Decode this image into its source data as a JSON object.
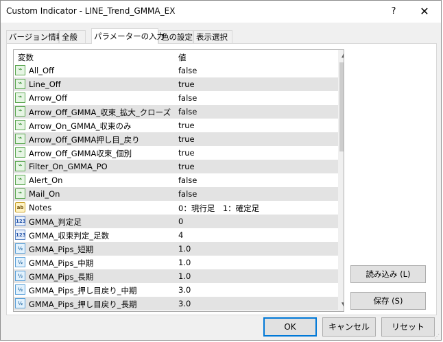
{
  "window": {
    "title": "Custom Indicator - LINE_Trend_GMMA_EX",
    "help_label": "?",
    "close_label": "✕"
  },
  "tabs": [
    {
      "label": "バージョン情報",
      "active": false
    },
    {
      "label": "全般",
      "active": false
    },
    {
      "label": "パラメーターの入力",
      "active": true
    },
    {
      "label": "色の設定",
      "active": false
    },
    {
      "label": "表示選択",
      "active": false
    }
  ],
  "grid": {
    "header": {
      "variable": "変数",
      "value": "値"
    },
    "rows": [
      {
        "icon": "trend-icon",
        "name": "All_Off",
        "value": "false"
      },
      {
        "icon": "trend-icon",
        "name": "Line_Off",
        "value": "true"
      },
      {
        "icon": "trend-icon",
        "name": "Arrow_Off",
        "value": "false"
      },
      {
        "icon": "trend-icon",
        "name": "Arrow_Off_GMMA_収束_拡大_クローズ",
        "value": "false"
      },
      {
        "icon": "trend-icon",
        "name": "Arrow_On_GMMA_収束のみ",
        "value": "true"
      },
      {
        "icon": "trend-icon",
        "name": "Arrow_Off_GMMA押し目_戻り",
        "value": "true"
      },
      {
        "icon": "trend-icon",
        "name": "Arrow_Off_GMMA収束_個別",
        "value": "true"
      },
      {
        "icon": "trend-icon",
        "name": "Filter_On_GMMA_PO",
        "value": "true"
      },
      {
        "icon": "trend-icon",
        "name": "Alert_On",
        "value": "false"
      },
      {
        "icon": "trend-icon",
        "name": "Mail_On",
        "value": "false"
      },
      {
        "icon": "text-icon",
        "name": "Notes",
        "value": "0：現行足　1：確定足"
      },
      {
        "icon": "integer-icon",
        "name": "GMMA_判定足",
        "value": "0"
      },
      {
        "icon": "integer-icon",
        "name": "GMMA_収束判定_足数",
        "value": "4"
      },
      {
        "icon": "double-icon",
        "name": "GMMA_Pips_短期",
        "value": "1.0"
      },
      {
        "icon": "double-icon",
        "name": "GMMA_Pips_中期",
        "value": "1.0"
      },
      {
        "icon": "double-icon",
        "name": "GMMA_Pips_長期",
        "value": "1.0"
      },
      {
        "icon": "double-icon",
        "name": "GMMA_Pips_押し目戻り_中期",
        "value": "3.0"
      },
      {
        "icon": "double-icon",
        "name": "GMMA_Pips_押し目戻り_長期",
        "value": "3.0"
      }
    ]
  },
  "icon_glyphs": {
    "trend-icon": "⌁",
    "text-icon": "ab",
    "integer-icon": "123",
    "double-icon": "½"
  },
  "side_buttons": {
    "load": "読み込み (L)",
    "save": "保存 (S)"
  },
  "buttons": {
    "ok": "OK",
    "cancel": "キャンセル",
    "reset": "リセット"
  },
  "colors": {
    "accent": "#0078d7",
    "alt_row": "#e3e3e3",
    "dialog_bg": "#f0f0f0"
  }
}
